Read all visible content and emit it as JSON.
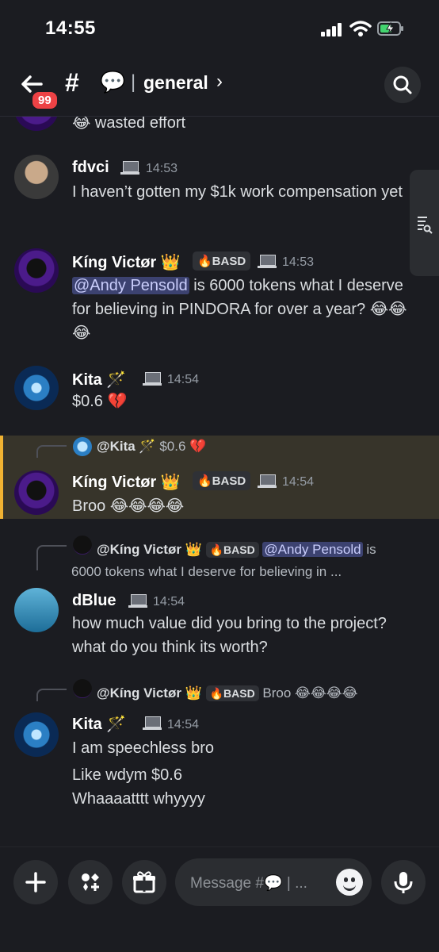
{
  "status": {
    "time": "14:55"
  },
  "header": {
    "back_badge": "99",
    "hash": "#",
    "channel_emoji": "💬",
    "separator": "|",
    "channel_name": "general",
    "chevron": "›"
  },
  "messages": [
    {
      "id": "m0",
      "text": "😂 wasted effort"
    },
    {
      "id": "m1",
      "author": "fdvci",
      "time": "14:53",
      "text": "I haven’t gotten my $1k work compensation yet"
    },
    {
      "id": "m2",
      "author": "Kíng Victør 👑",
      "tag": "🔥BASD",
      "time": "14:53",
      "mention": "@Andy Pensold",
      "text": " is 6000 tokens what I deserve for believing in PINDORA for over a year? 😂😂😂"
    },
    {
      "id": "m3",
      "author": "Kita 🪄",
      "time": "14:54",
      "text": "$0.6 💔"
    },
    {
      "id": "m4",
      "reply_user": "@Kita 🪄",
      "reply_text": "$0.6 💔",
      "author": "Kíng Victør 👑",
      "tag": "🔥BASD",
      "time": "14:54",
      "text": "Broo 😂😂😂😂"
    },
    {
      "id": "m5",
      "reply_user": "@Kíng Victør 👑",
      "reply_tag": "🔥BASD",
      "reply_mention": "@Andy Pensold",
      "reply_text": " is",
      "reply_text2": "6000 tokens what I deserve for believing in ...",
      "author": "dBlue",
      "time": "14:54",
      "text": "how much value did you bring to the project? what do you think its worth?"
    },
    {
      "id": "m6",
      "reply_user": "@Kíng Victør 👑",
      "reply_tag": "🔥BASD",
      "reply_text": "Broo 😂😂😂😂",
      "author": "Kita 🪄",
      "time": "14:54",
      "lines": [
        "I am speechless bro",
        "Like wdym $0.6",
        "Whaaaatttt whyyyy"
      ]
    }
  ],
  "composer": {
    "placeholder": "Message #💬 | ..."
  },
  "icons": [
    "back-arrow-icon",
    "search-icon",
    "members-list-icon",
    "plus-icon",
    "apps-icon",
    "gift-icon",
    "emoji-icon",
    "microphone-icon"
  ]
}
